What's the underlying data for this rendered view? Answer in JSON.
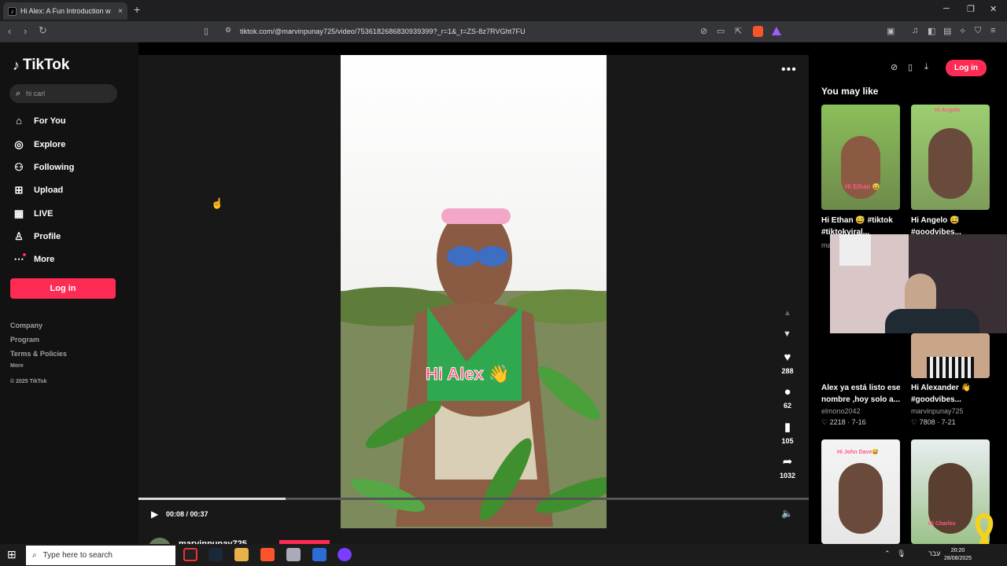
{
  "browser": {
    "tab_title": "Hi Alex: A Fun Introduction w",
    "tab_close": "×",
    "new_tab": "+",
    "url": "tiktok.com/@marvinpunay725/video/7536182686830939399?_r=1&_t=ZS-8z7RVGht7FU",
    "window_controls": [
      "─",
      "❐",
      "✕"
    ]
  },
  "sidebar": {
    "logo": "TikTok",
    "search_value": "hi carl",
    "items": [
      {
        "label": "For You",
        "icon": "home-icon"
      },
      {
        "label": "Explore",
        "icon": "compass-icon"
      },
      {
        "label": "Following",
        "icon": "following-icon"
      },
      {
        "label": "Upload",
        "icon": "upload-icon"
      },
      {
        "label": "LIVE",
        "icon": "live-icon"
      },
      {
        "label": "Profile",
        "icon": "profile-icon"
      },
      {
        "label": "More",
        "icon": "more-icon"
      }
    ],
    "login": "Log in",
    "footer": [
      "Company",
      "Program",
      "Terms & Policies"
    ],
    "footer_more": "More",
    "copyright": "© 2025 TikTok"
  },
  "video": {
    "caption_overlay": "Hi Alex 👋",
    "likes": "288",
    "comments": "62",
    "saves": "105",
    "shares": "1032",
    "time": "00:08 / 00:37",
    "progress_fraction": 0.22,
    "author": "marvinpunay725"
  },
  "right_panel": {
    "login": "Log in",
    "heading": "You may like",
    "cards": [
      {
        "caption": "Hi Ethan 😅 #tiktok #tiktokviral...",
        "author": "ma",
        "stats": "",
        "overlay": "Hi Ethan 😅"
      },
      {
        "caption": "Hi Angelo 😅 #goodvibes...",
        "author": "",
        "stats": "",
        "overlay": "Hi Angelo"
      },
      {
        "caption": "Alex ya está listo ese nombre ,hoy solo a...",
        "author": "elmono2042",
        "stats": "♡ 2218 · 7-16",
        "overlay": ""
      },
      {
        "caption": "Hi Alexander 👋 #goodvibes...",
        "author": "marvinpunay725",
        "stats": "♡ 7808 · 7-21",
        "overlay": ""
      },
      {
        "caption": "",
        "author": "",
        "stats": "",
        "overlay": "Hi John Dave😅"
      },
      {
        "caption": "",
        "author": "",
        "stats": "",
        "overlay": "Hi Charles"
      }
    ]
  },
  "taskbar": {
    "search_placeholder": "Type here to search",
    "lang": "עבר",
    "time": "20:20",
    "date": "28/08/2025"
  }
}
